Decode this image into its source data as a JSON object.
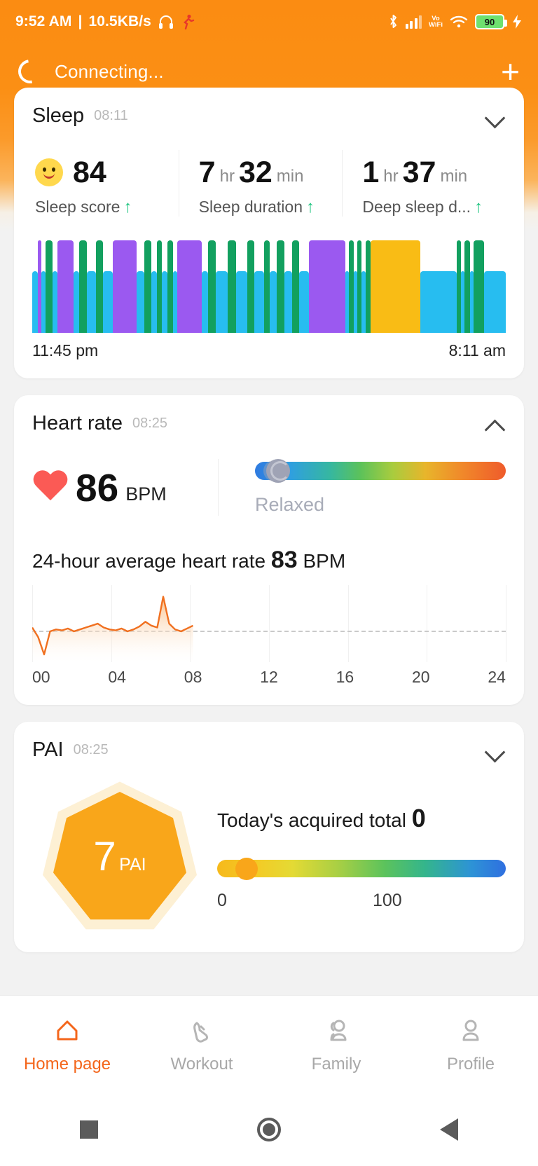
{
  "status_bar": {
    "time": "9:52 AM",
    "separator": "|",
    "net_speed": "10.5KB/s",
    "headphone_icon": "headphone-icon",
    "run_icon": "running-icon",
    "bluetooth_icon": "bluetooth-icon",
    "signal_icon": "cellular-signal-icon",
    "volte_line1": "Vo",
    "volte_line2": "WiFi",
    "wifi_icon": "wifi-icon",
    "battery_level": "90",
    "charging_icon": "charging-bolt-icon"
  },
  "app_bar": {
    "status_text": "Connecting...",
    "spinner_icon": "loading-spinner-icon",
    "add_label": "+"
  },
  "sleep": {
    "title": "Sleep",
    "time": "08:11",
    "collapse_icon": "chevron-down-icon",
    "metrics": [
      {
        "icon": "smiley-face-icon",
        "big": "84",
        "unit": "",
        "big2": "",
        "unit2": "",
        "label": "Sleep score",
        "trend": "↑"
      },
      {
        "icon": "",
        "big": "7",
        "unit": "hr",
        "big2": "32",
        "unit2": "min",
        "label": "Sleep duration",
        "trend": "↑"
      },
      {
        "icon": "",
        "big": "1",
        "unit": "hr",
        "big2": "37",
        "unit2": "min",
        "label": "Deep sleep d...",
        "trend": "↑"
      }
    ],
    "axis_start": "11:45 pm",
    "axis_end": "8:11 am",
    "legend_colors": {
      "light": "#27bdf0",
      "deep": "#12a05f",
      "rem": "#9b59f0",
      "awake": "#f9bc15"
    },
    "chart_data": {
      "type": "bar",
      "title": "Sleep stages hypnogram",
      "xlabel": "",
      "ylabel": "",
      "x_range": [
        "11:45 pm",
        "8:11 am"
      ],
      "stage_colors": {
        "light": "#27bdf0",
        "deep": "#12a05f",
        "rem": "#9b59f0",
        "awake": "#f9bc15"
      },
      "segments": [
        {
          "start": 0.0,
          "width": 1.2,
          "stage": "light"
        },
        {
          "start": 1.2,
          "width": 0.7,
          "stage": "rem"
        },
        {
          "start": 1.9,
          "width": 0.9,
          "stage": "light"
        },
        {
          "start": 2.8,
          "width": 1.5,
          "stage": "deep"
        },
        {
          "start": 4.3,
          "width": 1.0,
          "stage": "light"
        },
        {
          "start": 5.3,
          "width": 3.4,
          "stage": "rem"
        },
        {
          "start": 8.7,
          "width": 1.2,
          "stage": "light"
        },
        {
          "start": 9.9,
          "width": 1.6,
          "stage": "deep"
        },
        {
          "start": 11.5,
          "width": 2.0,
          "stage": "light"
        },
        {
          "start": 13.5,
          "width": 1.4,
          "stage": "deep"
        },
        {
          "start": 14.9,
          "width": 2.1,
          "stage": "light"
        },
        {
          "start": 17.0,
          "width": 5.0,
          "stage": "rem"
        },
        {
          "start": 22.0,
          "width": 1.6,
          "stage": "light"
        },
        {
          "start": 23.6,
          "width": 1.5,
          "stage": "deep"
        },
        {
          "start": 25.1,
          "width": 1.2,
          "stage": "light"
        },
        {
          "start": 26.3,
          "width": 1.0,
          "stage": "deep"
        },
        {
          "start": 27.3,
          "width": 1.3,
          "stage": "light"
        },
        {
          "start": 28.6,
          "width": 1.1,
          "stage": "deep"
        },
        {
          "start": 29.7,
          "width": 0.9,
          "stage": "light"
        },
        {
          "start": 30.6,
          "width": 5.2,
          "stage": "rem"
        },
        {
          "start": 35.8,
          "width": 1.3,
          "stage": "light"
        },
        {
          "start": 37.1,
          "width": 1.6,
          "stage": "deep"
        },
        {
          "start": 38.7,
          "width": 2.6,
          "stage": "light"
        },
        {
          "start": 41.3,
          "width": 1.8,
          "stage": "deep"
        },
        {
          "start": 43.1,
          "width": 2.3,
          "stage": "light"
        },
        {
          "start": 45.4,
          "width": 1.5,
          "stage": "deep"
        },
        {
          "start": 46.9,
          "width": 2.0,
          "stage": "light"
        },
        {
          "start": 48.9,
          "width": 1.3,
          "stage": "deep"
        },
        {
          "start": 50.2,
          "width": 1.4,
          "stage": "light"
        },
        {
          "start": 51.6,
          "width": 1.7,
          "stage": "deep"
        },
        {
          "start": 53.3,
          "width": 1.6,
          "stage": "light"
        },
        {
          "start": 54.9,
          "width": 1.4,
          "stage": "deep"
        },
        {
          "start": 56.3,
          "width": 2.2,
          "stage": "light"
        },
        {
          "start": 58.5,
          "width": 7.6,
          "stage": "rem"
        },
        {
          "start": 66.1,
          "width": 0.8,
          "stage": "light"
        },
        {
          "start": 66.9,
          "width": 1.0,
          "stage": "deep"
        },
        {
          "start": 67.9,
          "width": 0.7,
          "stage": "light"
        },
        {
          "start": 68.6,
          "width": 1.0,
          "stage": "deep"
        },
        {
          "start": 69.6,
          "width": 0.8,
          "stage": "light"
        },
        {
          "start": 70.4,
          "width": 1.1,
          "stage": "deep"
        },
        {
          "start": 71.5,
          "width": 10.5,
          "stage": "awake"
        },
        {
          "start": 82.0,
          "width": 7.6,
          "stage": "light"
        },
        {
          "start": 89.6,
          "width": 1.0,
          "stage": "deep"
        },
        {
          "start": 90.6,
          "width": 0.7,
          "stage": "light"
        },
        {
          "start": 91.3,
          "width": 1.1,
          "stage": "deep"
        },
        {
          "start": 92.4,
          "width": 0.8,
          "stage": "light"
        },
        {
          "start": 93.2,
          "width": 2.2,
          "stage": "deep"
        },
        {
          "start": 95.4,
          "width": 4.6,
          "stage": "light"
        }
      ]
    }
  },
  "heart_rate": {
    "title": "Heart rate",
    "time": "08:25",
    "collapse_icon": "chevron-up-icon",
    "heart_icon": "heart-icon",
    "value": "86",
    "unit": "BPM",
    "state": "Relaxed",
    "avg_prefix": "24-hour average heart rate",
    "avg_value": "83",
    "avg_unit": "BPM",
    "chart_data": {
      "type": "line",
      "title": "24-hour heart rate",
      "xlabel": "",
      "ylabel": "BPM",
      "tick_labels": [
        "00",
        "04",
        "08",
        "12",
        "16",
        "20",
        "24"
      ],
      "xlim": [
        0,
        24
      ],
      "ylim": [
        50,
        130
      ],
      "grid": true,
      "line_color": "#f07020",
      "fill": "gradient-orange-fade",
      "dashed_baseline_value": 83,
      "x": [
        0.0,
        0.3,
        0.6,
        0.9,
        1.2,
        1.5,
        1.8,
        2.1,
        2.4,
        2.7,
        3.0,
        3.3,
        3.6,
        3.9,
        4.2,
        4.5,
        4.8,
        5.1,
        5.4,
        5.7,
        6.0,
        6.3,
        6.6,
        6.9,
        7.2,
        7.5,
        7.8,
        8.1
      ],
      "y": [
        86,
        76,
        58,
        82,
        84,
        83,
        85,
        82,
        84,
        86,
        88,
        90,
        86,
        84,
        83,
        85,
        82,
        84,
        87,
        92,
        88,
        86,
        118,
        90,
        84,
        82,
        85,
        88
      ]
    }
  },
  "pai": {
    "title": "PAI",
    "time": "08:25",
    "collapse_icon": "chevron-down-icon",
    "score": "7",
    "score_label": "PAI",
    "total_prefix": "Today's acquired total",
    "total_value": "0",
    "axis_min": "0",
    "axis_max": "100",
    "chart_data": {
      "type": "bar",
      "title": "PAI weekly score gauge",
      "categories": [
        "0",
        "100"
      ],
      "values": [
        7,
        0
      ],
      "ylim": [
        0,
        100
      ],
      "gauge_position_percent": 7
    }
  },
  "bottom_nav": {
    "items": [
      {
        "label": "Home page",
        "icon": "home-icon",
        "active": true
      },
      {
        "label": "Workout",
        "icon": "shoe-icon",
        "active": false
      },
      {
        "label": "Family",
        "icon": "people-icon",
        "active": false
      },
      {
        "label": "Profile",
        "icon": "person-icon",
        "active": false
      }
    ],
    "accent_color": "#f4661b"
  },
  "system_nav": {
    "recents_icon": "square-recents-icon",
    "home_icon": "circle-home-icon",
    "back_icon": "triangle-back-icon"
  }
}
